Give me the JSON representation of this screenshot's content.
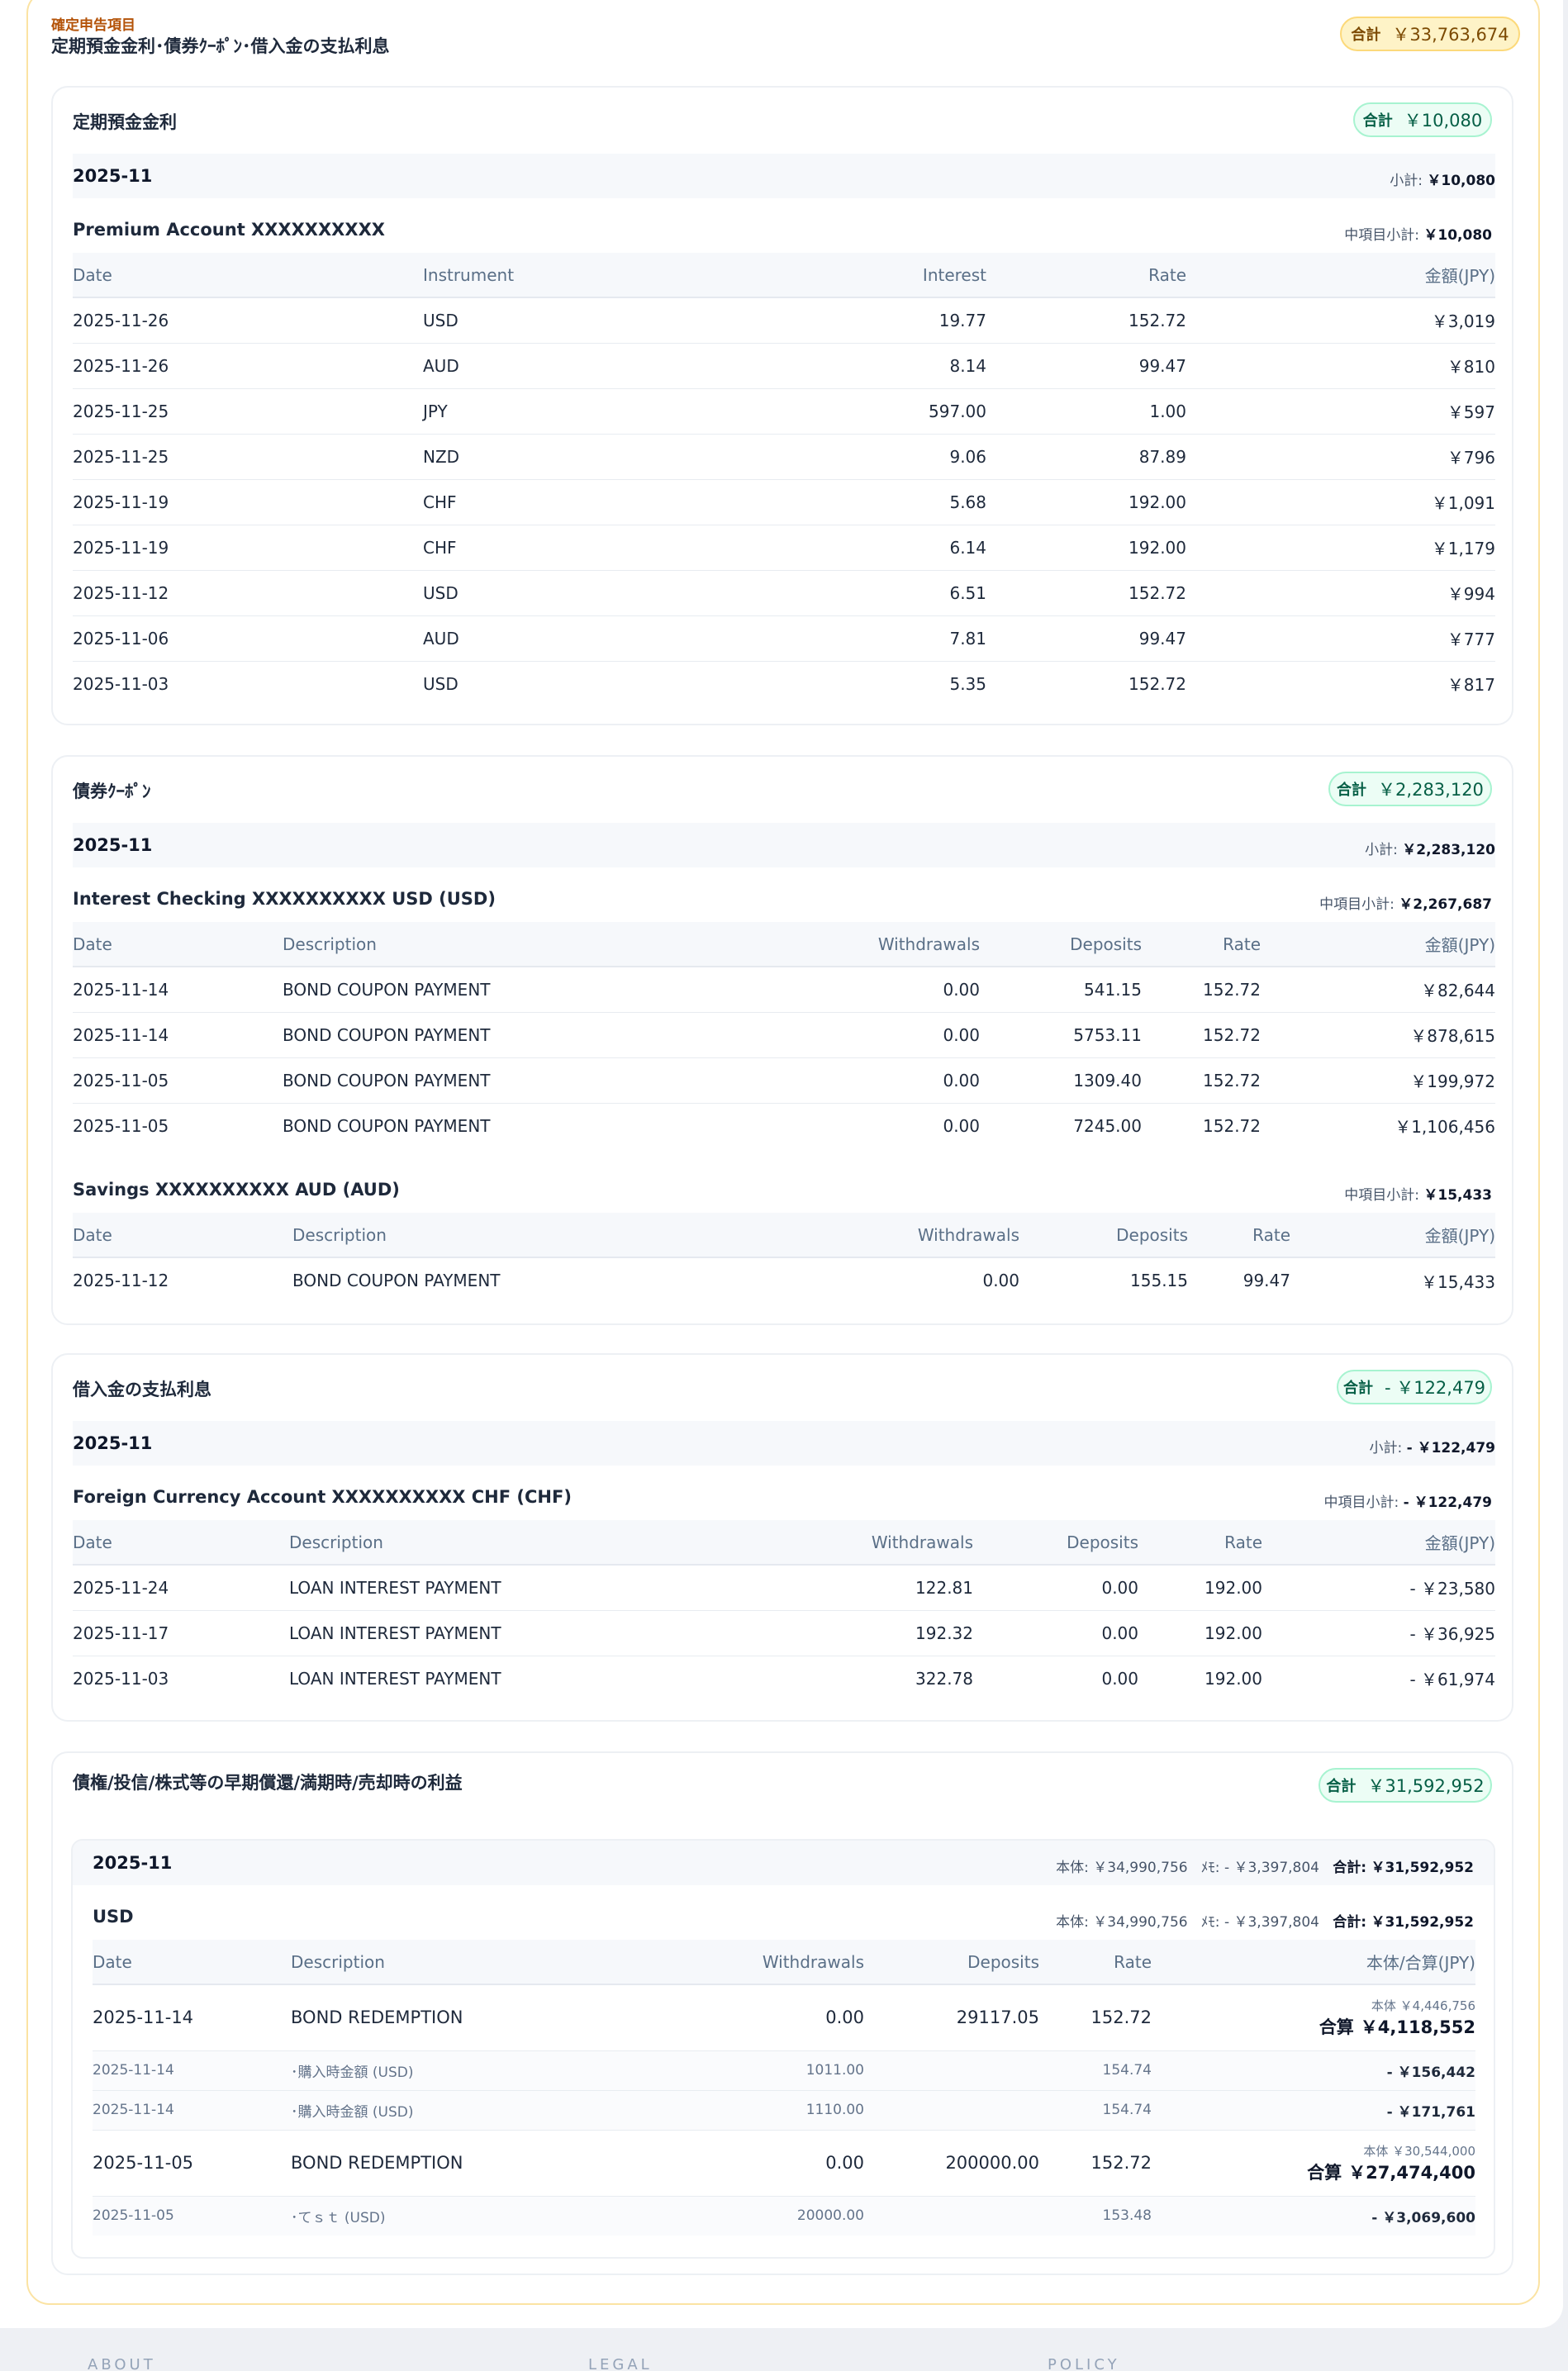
{
  "header": {
    "eyebrow": "確定申告項目",
    "title": "定期預金金利･債券ｸｰﾎﾟﾝ･借入金の支払利息",
    "total_label": "合計",
    "total_value": "￥33,763,674"
  },
  "time_deposit": {
    "title": "定期預金金利",
    "total_label": "合計",
    "total_value": "￥10,080",
    "month": "2025-11",
    "subtotal_label": "小計:",
    "subtotal_value": "￥10,080",
    "account": "Premium Account XXXXXXXXXX",
    "account_subtotal_label": "中項目小計:",
    "account_subtotal_value": "￥10,080",
    "columns": [
      "Date",
      "Instrument",
      "Interest",
      "Rate",
      "金額(JPY)"
    ],
    "rows": [
      [
        "2025-11-26",
        "USD",
        "19.77",
        "152.72",
        "￥3,019"
      ],
      [
        "2025-11-26",
        "AUD",
        "8.14",
        "99.47",
        "￥810"
      ],
      [
        "2025-11-25",
        "JPY",
        "597.00",
        "1.00",
        "￥597"
      ],
      [
        "2025-11-25",
        "NZD",
        "9.06",
        "87.89",
        "￥796"
      ],
      [
        "2025-11-19",
        "CHF",
        "5.68",
        "192.00",
        "￥1,091"
      ],
      [
        "2025-11-19",
        "CHF",
        "6.14",
        "192.00",
        "￥1,179"
      ],
      [
        "2025-11-12",
        "USD",
        "6.51",
        "152.72",
        "￥994"
      ],
      [
        "2025-11-06",
        "AUD",
        "7.81",
        "99.47",
        "￥777"
      ],
      [
        "2025-11-03",
        "USD",
        "5.35",
        "152.72",
        "￥817"
      ]
    ]
  },
  "bond_coupon": {
    "title": "債券ｸｰﾎﾟﾝ",
    "total_label": "合計",
    "total_value": "￥2,283,120",
    "month": "2025-11",
    "subtotal_label": "小計:",
    "subtotal_value": "￥2,283,120",
    "accounts": [
      {
        "name": "Interest Checking XXXXXXXXXX USD (USD)",
        "subtotal_label": "中項目小計:",
        "subtotal_value": "￥2,267,687",
        "columns": [
          "Date",
          "Description",
          "Withdrawals",
          "Deposits",
          "Rate",
          "金額(JPY)"
        ],
        "rows": [
          [
            "2025-11-14",
            "BOND COUPON PAYMENT",
            "0.00",
            "541.15",
            "152.72",
            "￥82,644"
          ],
          [
            "2025-11-14",
            "BOND COUPON PAYMENT",
            "0.00",
            "5753.11",
            "152.72",
            "￥878,615"
          ],
          [
            "2025-11-05",
            "BOND COUPON PAYMENT",
            "0.00",
            "1309.40",
            "152.72",
            "￥199,972"
          ],
          [
            "2025-11-05",
            "BOND COUPON PAYMENT",
            "0.00",
            "7245.00",
            "152.72",
            "￥1,106,456"
          ]
        ]
      },
      {
        "name": "Savings XXXXXXXXXX AUD (AUD)",
        "subtotal_label": "中項目小計:",
        "subtotal_value": "￥15,433",
        "columns": [
          "Date",
          "Description",
          "Withdrawals",
          "Deposits",
          "Rate",
          "金額(JPY)"
        ],
        "rows": [
          [
            "2025-11-12",
            "BOND COUPON PAYMENT",
            "0.00",
            "155.15",
            "99.47",
            "￥15,433"
          ]
        ]
      }
    ]
  },
  "loan_interest": {
    "title": "借入金の支払利息",
    "total_label": "合計",
    "total_value": "- ￥122,479",
    "month": "2025-11",
    "subtotal_label": "小計:",
    "subtotal_value": "- ￥122,479",
    "account": "Foreign Currency Account XXXXXXXXXX CHF (CHF)",
    "account_subtotal_label": "中項目小計:",
    "account_subtotal_value": "- ￥122,479",
    "columns": [
      "Date",
      "Description",
      "Withdrawals",
      "Deposits",
      "Rate",
      "金額(JPY)"
    ],
    "rows": [
      [
        "2025-11-24",
        "LOAN INTEREST PAYMENT",
        "122.81",
        "0.00",
        "192.00",
        "- ￥23,580"
      ],
      [
        "2025-11-17",
        "LOAN INTEREST PAYMENT",
        "192.32",
        "0.00",
        "192.00",
        "- ￥36,925"
      ],
      [
        "2025-11-03",
        "LOAN INTEREST PAYMENT",
        "322.78",
        "0.00",
        "192.00",
        "- ￥61,974"
      ]
    ]
  },
  "redemption": {
    "title": "債権/投信/株式等の早期償還/満期時/売却時の利益",
    "total_label": "合計",
    "total_value": "￥31,592,952",
    "month": "2025-11",
    "month_principal": "本体: ￥34,990,756",
    "month_memo": "ﾒﾓ: - ￥3,397,804",
    "month_total_label": "合計:",
    "month_total_value": "￥31,592,952",
    "currency": "USD",
    "currency_principal": "本体: ￥34,990,756",
    "currency_memo": "ﾒﾓ: - ￥3,397,804",
    "currency_total_label": "合計:",
    "currency_total_value": "￥31,592,952",
    "columns": [
      "Date",
      "Description",
      "Withdrawals",
      "Deposits",
      "Rate",
      "本体/合算(JPY)"
    ],
    "rows": [
      {
        "kind": "main",
        "date": "2025-11-14",
        "desc": "BOND REDEMPTION",
        "withdrawals": "0.00",
        "deposits": "29117.05",
        "rate": "152.72",
        "principal": "本体 ￥4,446,756",
        "combined_label": "合算",
        "combined_value": "￥4,118,552"
      },
      {
        "kind": "sub",
        "date": "2025-11-14",
        "desc": "･購入時金額 (USD)",
        "withdrawals": "1011.00",
        "deposits": "",
        "rate": "154.74",
        "amount": "- ￥156,442"
      },
      {
        "kind": "sub",
        "date": "2025-11-14",
        "desc": "･購入時金額 (USD)",
        "withdrawals": "1110.00",
        "deposits": "",
        "rate": "154.74",
        "amount": "- ￥171,761"
      },
      {
        "kind": "main",
        "date": "2025-11-05",
        "desc": "BOND REDEMPTION",
        "withdrawals": "0.00",
        "deposits": "200000.00",
        "rate": "152.72",
        "principal": "本体 ￥30,544,000",
        "combined_label": "合算",
        "combined_value": "￥27,474,400"
      },
      {
        "kind": "sub",
        "date": "2025-11-05",
        "desc": "･てｓｔ (USD)",
        "withdrawals": "20000.00",
        "deposits": "",
        "rate": "153.48",
        "amount": "- ￥3,069,600"
      }
    ]
  },
  "footer": {
    "col1": "ABOUT",
    "col2": "LEGAL",
    "col3": "POLICY"
  }
}
